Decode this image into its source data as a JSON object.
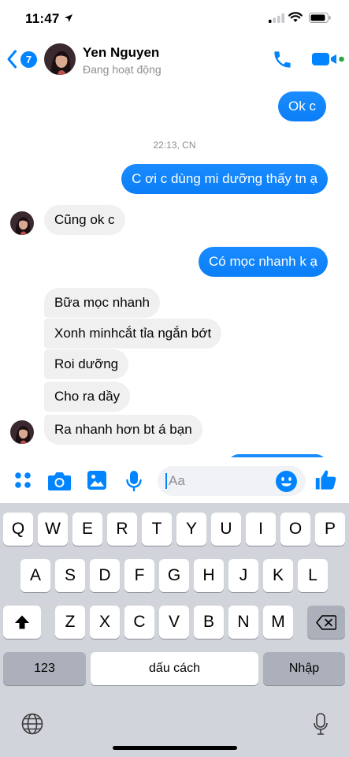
{
  "status_bar": {
    "time": "11:47"
  },
  "header": {
    "back_badge": "7",
    "contact_name": "Yen Nguyen",
    "contact_status": "Đang hoạt động"
  },
  "chat": {
    "messages": [
      {
        "side": "out",
        "text": "Ok c"
      },
      {
        "side": "out",
        "text": "C ơi c dùng mi dưỡng thấy tn ạ"
      },
      {
        "side": "in",
        "text": "Cũng ok c"
      },
      {
        "side": "out",
        "text": "Có mọc nhanh k ạ"
      },
      {
        "side": "in",
        "text": "Bữa mọc nhanh"
      },
      {
        "side": "in",
        "text": "Xonh minhcắt tỉa ngắn bớt"
      },
      {
        "side": "in",
        "text": "Roi dưỡng"
      },
      {
        "side": "in",
        "text": "Cho ra dầy"
      },
      {
        "side": "in",
        "text": "Ra nhanh hơn bt á bạn"
      }
    ],
    "timestamp": "22:13, CN"
  },
  "composer": {
    "placeholder": "Aa"
  },
  "keyboard": {
    "row1": [
      "Q",
      "W",
      "E",
      "R",
      "T",
      "Y",
      "U",
      "I",
      "O",
      "P"
    ],
    "row2": [
      "A",
      "S",
      "D",
      "F",
      "G",
      "H",
      "J",
      "K",
      "L"
    ],
    "row3": [
      "Z",
      "X",
      "C",
      "V",
      "B",
      "N",
      "M"
    ],
    "numbers_label": "123",
    "space_label": "dấu cách",
    "return_label": "Nhập"
  },
  "colors": {
    "accent": "#0084ff",
    "incoming_bubble": "#f0f0f0",
    "keyboard_bg": "#d1d4da"
  }
}
